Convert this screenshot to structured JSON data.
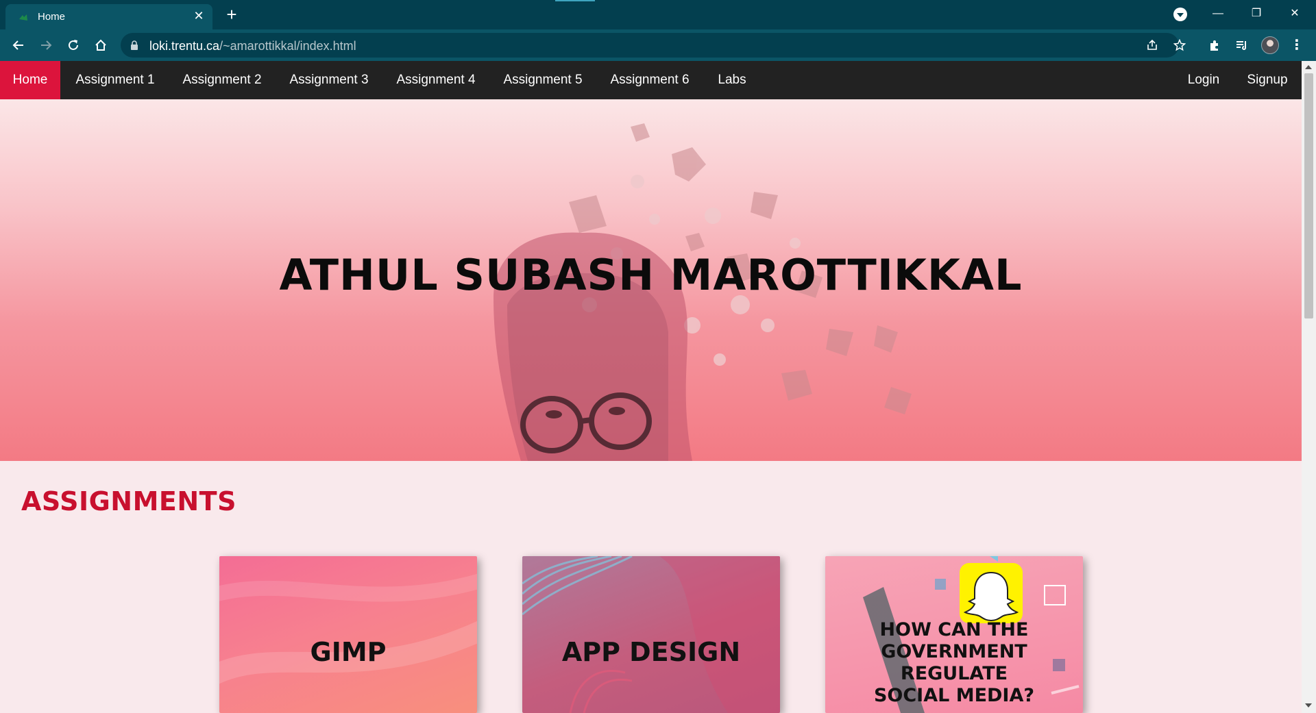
{
  "browser": {
    "tab": {
      "title": "Home",
      "close_glyph": "✕"
    },
    "new_tab_glyph": "+",
    "window_controls": {
      "minimize": "—",
      "restore": "❐",
      "close": "✕"
    },
    "url_host": "loki.trentu.ca",
    "url_path": "/~amarottikkal/index.html",
    "icons": [
      "back-icon",
      "forward-icon",
      "reload-icon",
      "home-icon",
      "lock-icon",
      "share-icon",
      "star-icon",
      "extensions-icon",
      "media-control-icon",
      "profile-avatar",
      "more-menu-icon"
    ],
    "menu_glyph": "⋮"
  },
  "nav": {
    "items": [
      {
        "label": "Home",
        "active": true
      },
      {
        "label": "Assignment 1"
      },
      {
        "label": "Assignment 2"
      },
      {
        "label": "Assignment 3"
      },
      {
        "label": "Assignment 4"
      },
      {
        "label": "Assignment 5"
      },
      {
        "label": "Assignment 6"
      },
      {
        "label": "Labs"
      }
    ],
    "right_items": [
      {
        "label": "Login"
      },
      {
        "label": "Signup"
      }
    ],
    "active_color": "#dc143c",
    "background": "#222222"
  },
  "hero": {
    "title": "ATHUL SUBASH MAROTTIKKAL"
  },
  "assignments": {
    "heading": "ASSIGNMENTS",
    "heading_color": "#c8102e",
    "cards": [
      {
        "title": "GIMP"
      },
      {
        "title": "APP DESIGN"
      },
      {
        "title_lines": [
          "HOW CAN THE",
          "GOVERNMENT REGULATE",
          "SOCIAL MEDIA?"
        ]
      }
    ]
  },
  "colors": {
    "chrome_dark": "#033f4f",
    "chrome_tab": "#0b5566",
    "page_background": "#f9e9ec"
  }
}
